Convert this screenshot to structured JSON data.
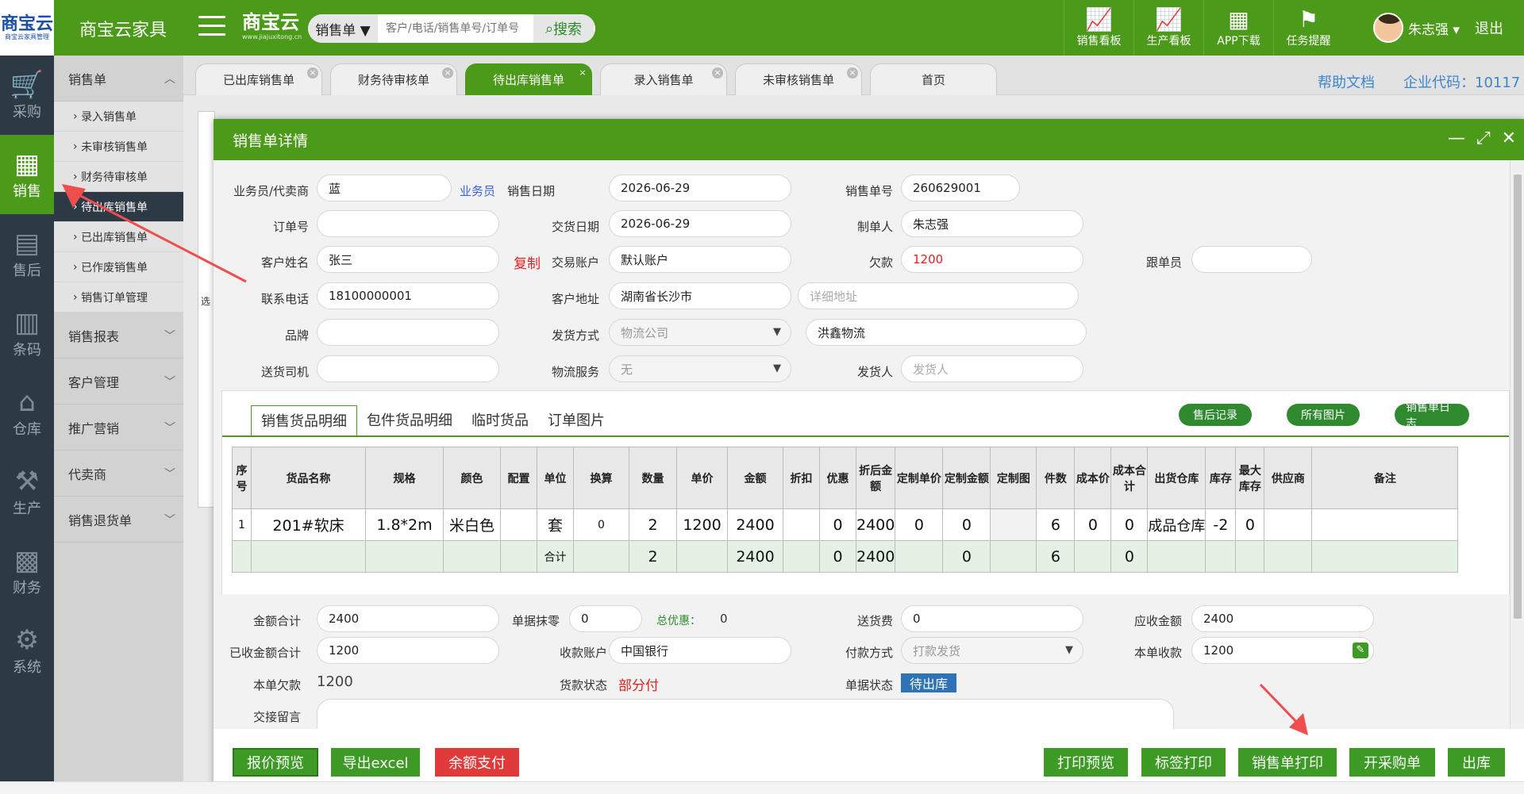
{
  "app": {
    "logo_text": "商宝云",
    "logo_sub": "商宝云家具管理",
    "name": "商宝云家具",
    "brand": "商宝云",
    "brand_url": "www.jiajuxitong.cn"
  },
  "search": {
    "type": "销售单 ▼",
    "placeholder": "客户/电话/销售单号/订单号",
    "button": "搜索"
  },
  "top_icons": [
    {
      "label": "销售看板",
      "icon": "chart-icon"
    },
    {
      "label": "生产看板",
      "icon": "chart-icon"
    },
    {
      "label": "APP下载",
      "icon": "qr-icon"
    },
    {
      "label": "任务提醒",
      "icon": "flag-icon"
    }
  ],
  "user": {
    "name": "朱志强 ▾",
    "logout": "退出"
  },
  "left_nav": [
    {
      "label": "采购"
    },
    {
      "label": "销售"
    },
    {
      "label": "售后"
    },
    {
      "label": "条码"
    },
    {
      "label": "仓库"
    },
    {
      "label": "生产"
    },
    {
      "label": "财务"
    },
    {
      "label": "系统"
    }
  ],
  "sidebar": {
    "head": "销售单",
    "items": [
      "录入销售单",
      "未审核销售单",
      "财务待审核单",
      "待出库销售单",
      "已出库销售单",
      "已作废销售单",
      "销售订单管理"
    ],
    "groups": [
      "销售报表",
      "客户管理",
      "推广营销",
      "代卖商",
      "销售退货单"
    ]
  },
  "tabs": [
    "已出库销售单",
    "财务待审核单",
    "待出库销售单",
    "录入销售单",
    "未审核销售单",
    "首页"
  ],
  "links": {
    "help": "帮助文档",
    "company_code": "企业代码：10117"
  },
  "behind_text": "选",
  "modal": {
    "title": "销售单详情",
    "form": {
      "salesman_label": "业务员/代卖商",
      "salesman": "蓝",
      "salesman_link": "业务员",
      "sale_date_label": "销售日期",
      "sale_date": "2026-06-29",
      "order_no_label": "销售单号",
      "order_no": "260629001",
      "ref_no_label": "订单号",
      "ref_no": "",
      "delivery_date_label": "交货日期",
      "delivery_date": "2026-06-29",
      "maker_label": "制单人",
      "maker": "朱志强",
      "customer_label": "客户姓名",
      "customer": "张三",
      "copy": "复制",
      "account_label": "交易账户",
      "account": "默认账户",
      "debt_label": "欠款",
      "debt": "1200",
      "follower_label": "跟单员",
      "follower": "",
      "phone_label": "联系电话",
      "phone": "18100000001",
      "addr_label": "客户地址",
      "addr": "湖南省长沙市",
      "addr_detail_ph": "详细地址",
      "brand_label": "品牌",
      "brand": "",
      "ship_label": "发货方式",
      "ship": "物流公司",
      "logistics": "洪鑫物流",
      "driver_label": "送货司机",
      "driver": "",
      "service_label": "物流服务",
      "service": "无",
      "shipper_label": "发货人",
      "shipper_ph": "发货人"
    },
    "detail_tabs": [
      "销售货品明细",
      "包件货品明细",
      "临时货品",
      "订单图片"
    ],
    "pill_buttons": [
      "售后记录",
      "所有图片",
      "销售单日志"
    ],
    "table": {
      "headers": [
        "序号",
        "货品名称",
        "规格",
        "颜色",
        "配置",
        "单位",
        "换算",
        "数量",
        "单价",
        "金额",
        "折扣",
        "优惠",
        "折后金额",
        "定制单价",
        "定制金额",
        "定制图",
        "件数",
        "成本价",
        "成本合计",
        "出货仓库",
        "库存",
        "最大库存",
        "供应商",
        "备注"
      ],
      "rows": [
        [
          "1",
          "201#软床",
          "1.8*2m",
          "米白色",
          "",
          "套",
          "0",
          "2",
          "1200",
          "2400",
          "",
          "0",
          "2400",
          "0",
          "0",
          "",
          "6",
          "0",
          "0",
          "成品仓库",
          "-2",
          "0",
          "",
          ""
        ]
      ],
      "sum": [
        "",
        "",
        "",
        "",
        "",
        "合计",
        "",
        "2",
        "",
        "2400",
        "",
        "0",
        "2400",
        "",
        "0",
        "",
        "6",
        "",
        "0",
        "",
        "",
        "",
        "",
        ""
      ]
    },
    "footer": {
      "total_label": "金额合计",
      "total": "2400",
      "round_label": "单据抹零",
      "round": "0",
      "discount_label": "总优惠：",
      "discount": "0",
      "delivery_fee_label": "送货费",
      "delivery_fee": "0",
      "receivable_label": "应收金额",
      "receivable": "2400",
      "received_label": "已收金额合计",
      "received": "1200",
      "pay_account_label": "收款账户",
      "pay_account": "中国银行",
      "pay_method_label": "付款方式",
      "pay_method": "打款发货",
      "this_received_label": "本单收款",
      "this_received": "1200",
      "this_debt_label": "本单欠款",
      "this_debt": "1200",
      "pay_status_label": "货款状态",
      "pay_status": "部分付",
      "doc_status_label": "单据状态",
      "doc_status": "待出库",
      "note_label": "交接留言"
    },
    "buttons_left": [
      "报价预览",
      "导出excel",
      "余额支付"
    ],
    "buttons_right": [
      "打印预览",
      "标签打印",
      "销售单打印",
      "开采购单",
      "出库"
    ]
  },
  "colors": {
    "green": "#4c9a1a",
    "dark": "#2d3a46",
    "red": "#e02020",
    "arrow": "#ef4e4e"
  }
}
